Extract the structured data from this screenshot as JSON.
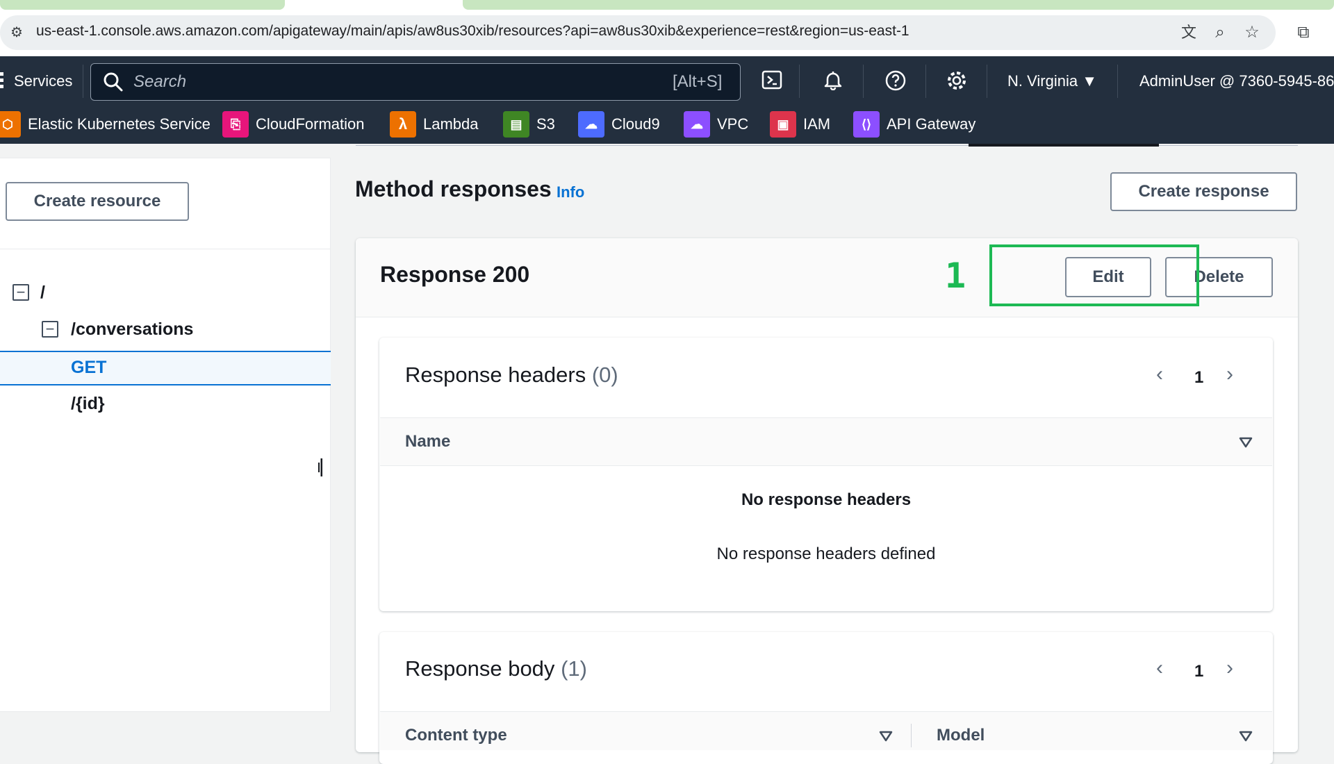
{
  "browser": {
    "url": "us-east-1.console.aws.amazon.com/apigateway/main/apis/aw8us30xib/resources?api=aw8us30xib&experience=rest&region=us-east-1"
  },
  "nav": {
    "services_label": "Services",
    "search_placeholder": "Search",
    "search_shortcut": "[Alt+S]",
    "region_label": "N. Virginia",
    "account_label": "AdminUser @ 7360-5945-86",
    "favorites": [
      {
        "label": "Elastic Kubernetes Service",
        "icon": "eks-icon",
        "color": "#ed7100"
      },
      {
        "label": "CloudFormation",
        "icon": "cloudformation-icon",
        "color": "#e7157b"
      },
      {
        "label": "Lambda",
        "icon": "lambda-icon",
        "color": "#ed7100"
      },
      {
        "label": "S3",
        "icon": "s3-icon",
        "color": "#3f8624"
      },
      {
        "label": "Cloud9",
        "icon": "cloud9-icon",
        "color": "#4d6bfe"
      },
      {
        "label": "VPC",
        "icon": "vpc-icon",
        "color": "#8c4fff"
      },
      {
        "label": "IAM",
        "icon": "iam-icon",
        "color": "#dd344c"
      },
      {
        "label": "API Gateway",
        "icon": "api-gateway-icon",
        "color": "#8c4fff"
      }
    ]
  },
  "sidebar": {
    "create_resource_label": "Create resource",
    "tree": [
      {
        "label": "/",
        "level": 0,
        "expandable": true
      },
      {
        "label": "/conversations",
        "level": 1,
        "expandable": true
      },
      {
        "label": "GET",
        "level": 2,
        "selected": true
      },
      {
        "label": "/{id}",
        "level": 2
      }
    ]
  },
  "main": {
    "section_title": "Method responses",
    "info_label": "Info",
    "create_response_label": "Create response",
    "response_title": "Response 200",
    "annotation_number": "1",
    "edit_label": "Edit",
    "delete_label": "Delete",
    "headers_title": "Response headers",
    "headers_count": "(0)",
    "headers_page": "1",
    "headers_col_name": "Name",
    "headers_empty_title": "No response headers",
    "headers_empty_desc": "No response headers defined",
    "body_title": "Response body",
    "body_count": "(1)",
    "body_page": "1",
    "body_col_content_type": "Content type",
    "body_col_model": "Model"
  },
  "colors": {
    "aws_nav": "#232f3e",
    "link_blue": "#0972d3",
    "selected_bg": "#f2f8fd",
    "annotation_green": "#1db954"
  }
}
